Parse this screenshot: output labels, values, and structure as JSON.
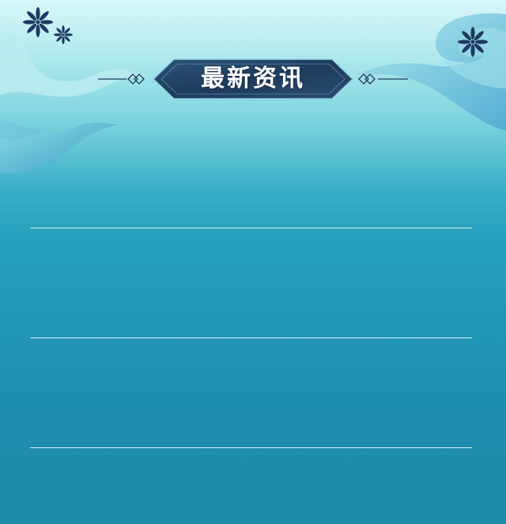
{
  "header": {
    "title": "最新资讯"
  },
  "news": {
    "items": [
      {
        "title": ""
      },
      {
        "title": ""
      },
      {
        "title": ""
      }
    ]
  },
  "colors": {
    "background_top": "#d9f6f8",
    "background_bottom": "#1f8aa8",
    "banner": "#1f3b5c",
    "flower": "#1d3b63",
    "divider": "#ffffff"
  },
  "icons": {
    "decoration": [
      "flower-icon",
      "diamond-ornament-icon"
    ]
  }
}
